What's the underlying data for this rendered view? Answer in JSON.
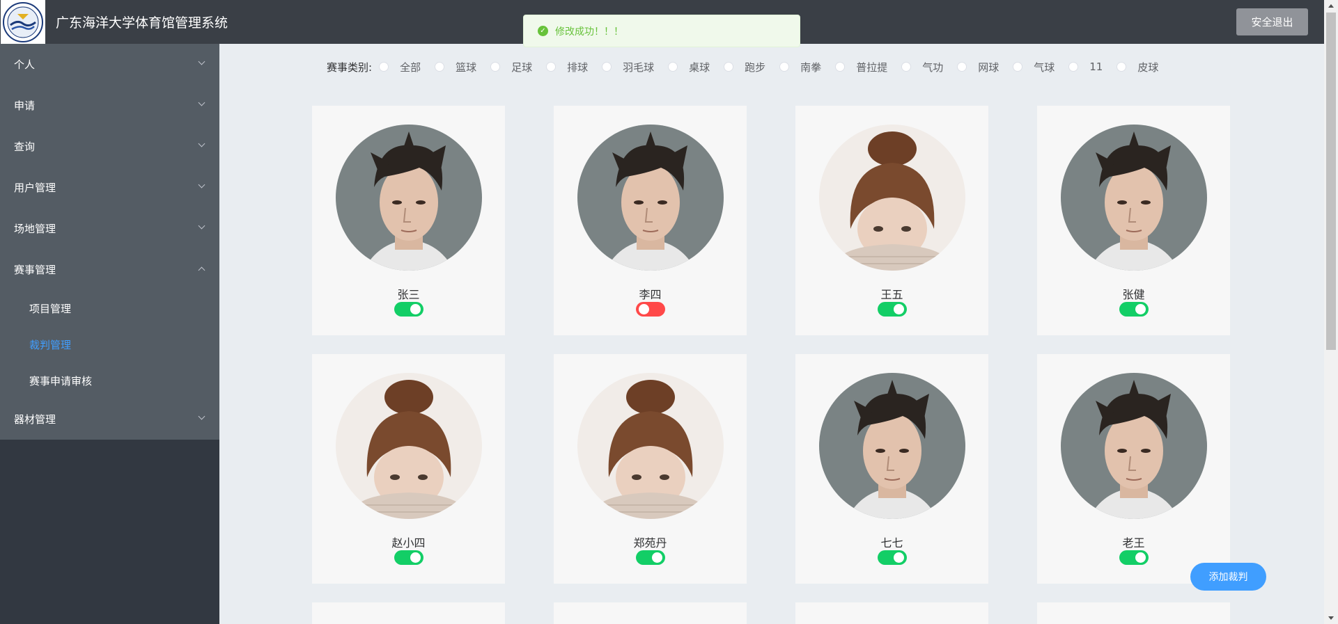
{
  "header": {
    "title": "广东海洋大学体育馆管理系统",
    "logout_label": "安全退出"
  },
  "toast": {
    "icon": "check-circle-icon",
    "message": "修改成功！！！",
    "color": "#67c23a"
  },
  "sidebar": {
    "items": [
      {
        "label": "个人",
        "expanded": false
      },
      {
        "label": "申请",
        "expanded": false
      },
      {
        "label": "查询",
        "expanded": false
      },
      {
        "label": "用户管理",
        "expanded": false
      },
      {
        "label": "场地管理",
        "expanded": false
      },
      {
        "label": "赛事管理",
        "expanded": true
      },
      {
        "label": "器材管理",
        "expanded": false
      }
    ],
    "submenu": [
      {
        "label": "项目管理",
        "active": false
      },
      {
        "label": "裁判管理",
        "active": true
      },
      {
        "label": "赛事申请审核",
        "active": false
      }
    ],
    "active_color": "#409eff"
  },
  "filter": {
    "label": "赛事类别:",
    "options": [
      "全部",
      "篮球",
      "足球",
      "排球",
      "羽毛球",
      "桌球",
      "跑步",
      "南拳",
      "普拉提",
      "气功",
      "网球",
      "气球",
      "11",
      "皮球"
    ]
  },
  "referees": [
    {
      "name": "张三",
      "enabled": true,
      "avatar": "male"
    },
    {
      "name": "李四",
      "enabled": false,
      "avatar": "male"
    },
    {
      "name": "王五",
      "enabled": true,
      "avatar": "female"
    },
    {
      "name": "张健",
      "enabled": true,
      "avatar": "male"
    },
    {
      "name": "赵小四",
      "enabled": true,
      "avatar": "female"
    },
    {
      "name": "郑苑丹",
      "enabled": true,
      "avatar": "female"
    },
    {
      "name": "七七",
      "enabled": true,
      "avatar": "male"
    },
    {
      "name": "老王",
      "enabled": true,
      "avatar": "male"
    }
  ],
  "add_button": {
    "label": "添加裁判"
  },
  "colors": {
    "switch_on": "#13ce66",
    "switch_off": "#ff4949",
    "primary": "#409eff"
  }
}
